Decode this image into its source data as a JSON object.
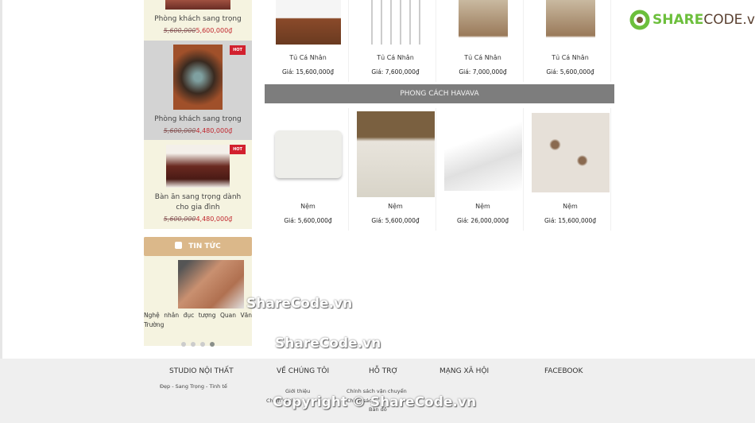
{
  "logo": {
    "brand": "SHARECODE.vn"
  },
  "sidebar": {
    "products": [
      {
        "name": "Phòng khách sang trọng",
        "old_price": "5,600,000",
        "new_price": "5,600,000₫",
        "hot": false
      },
      {
        "name": "Phòng khách sang trọng",
        "old_price": "5,600,000",
        "new_price": "4,480,000₫",
        "hot": true,
        "hot_label": "HOT"
      },
      {
        "name": "Bàn ăn sang trọng dành cho gia đình",
        "old_price": "5,600,000",
        "new_price": "4,480,000₫",
        "hot": true,
        "hot_label": "HOT"
      }
    ],
    "news": {
      "title": "TIN TỨC",
      "article": "Nghệ nhân đục tượng Quan Văn Trường",
      "slides": 4,
      "active_slide": 4
    }
  },
  "top_row": [
    {
      "name": "Tủ Cá Nhân",
      "price": "Giá: 15,600,000₫"
    },
    {
      "name": "Tủ Cá Nhân",
      "price": "Giá: 7,600,000₫"
    },
    {
      "name": "Tủ Cá Nhân",
      "price": "Giá: 7,000,000₫"
    },
    {
      "name": "Tủ Cá Nhân",
      "price": "Giá: 5,600,000₫"
    }
  ],
  "section": {
    "title": "PHONG CÁCH HAVAVA"
  },
  "havava": [
    {
      "name": "Nệm",
      "price": "Giá: 5,600,000₫"
    },
    {
      "name": "Nệm",
      "price": "Giá: 5,600,000₫"
    },
    {
      "name": "Nệm",
      "price": "Giá: 26,000,000₫"
    },
    {
      "name": "Nệm",
      "price": "Giá: 15,600,000₫"
    }
  ],
  "footer": {
    "col1": {
      "title": "STUDIO NỘI THẤT",
      "text": "Đẹp - Sang Trọng - Tinh tế"
    },
    "col2": {
      "title": "VỀ CHÚNG TÔI",
      "links": [
        "Giới thiệu",
        "Chính sách"
      ]
    },
    "col3": {
      "title": "HỖ TRỢ",
      "links": [
        "Chính sách vận chuyển",
        "Chính sách",
        "Bản đồ"
      ]
    },
    "col4": {
      "title": "MẠNG XÃ HỘI"
    },
    "col5": {
      "title": "FACEBOOK"
    }
  },
  "watermarks": [
    "ShareCode.vn",
    "ShareCode.vn",
    "Copyright © ShareCode.vn"
  ]
}
